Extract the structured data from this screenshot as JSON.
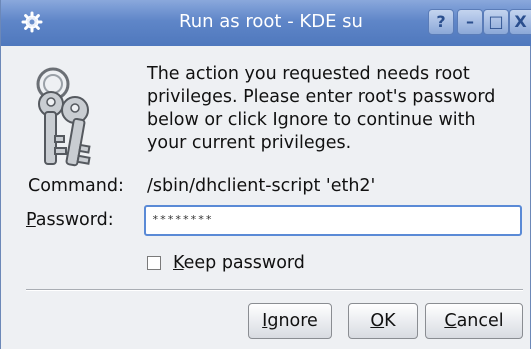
{
  "window": {
    "title": "Run as root - KDE su",
    "buttons": {
      "help": "?",
      "minimize": "–",
      "maximize": "□",
      "close": "X"
    }
  },
  "message": "The action you requested needs root privileges. Please enter root's password below or click Ignore to continue with your current privileges.",
  "command": {
    "label": "Command:",
    "value": "/sbin/dhclient-script 'eth2'"
  },
  "password": {
    "label_first": "P",
    "label_rest": "assword:",
    "value": "********"
  },
  "keep_password": {
    "checked": false,
    "label_first": "K",
    "label_rest": "eep password"
  },
  "actions": {
    "ignore_first": "I",
    "ignore_rest": "gnore",
    "ok_first": "O",
    "ok_rest": "K",
    "cancel_first": "C",
    "cancel_rest": "ancel"
  },
  "icons": {
    "window": "gear-icon",
    "dialog": "keys-icon"
  },
  "colors": {
    "titlebar": "#5f86c8",
    "focus": "#5a8ad6"
  }
}
